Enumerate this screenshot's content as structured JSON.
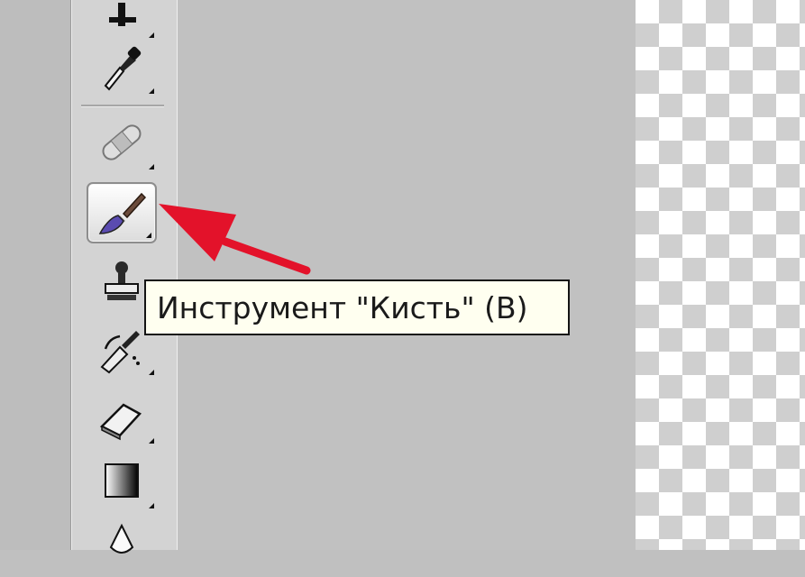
{
  "tooltip": {
    "text": "Инструмент \"Кисть\" (B)"
  },
  "tools": [
    {
      "name": "move-tool",
      "icon": "move-icon"
    },
    {
      "name": "eyedropper-tool",
      "icon": "eyedropper-icon"
    },
    {
      "name": "healing-brush-tool",
      "icon": "bandage-icon"
    },
    {
      "name": "brush-tool",
      "icon": "brush-icon",
      "active": true
    },
    {
      "name": "clone-stamp-tool",
      "icon": "stamp-icon"
    },
    {
      "name": "history-brush-tool",
      "icon": "history-brush-icon"
    },
    {
      "name": "eraser-tool",
      "icon": "eraser-icon"
    },
    {
      "name": "gradient-tool",
      "icon": "gradient-icon"
    },
    {
      "name": "blur-tool",
      "icon": "blur-icon"
    }
  ],
  "colors": {
    "arrow": "#e3122a",
    "tooltip_bg": "#fffff0",
    "panel": "#d3d3d3"
  }
}
